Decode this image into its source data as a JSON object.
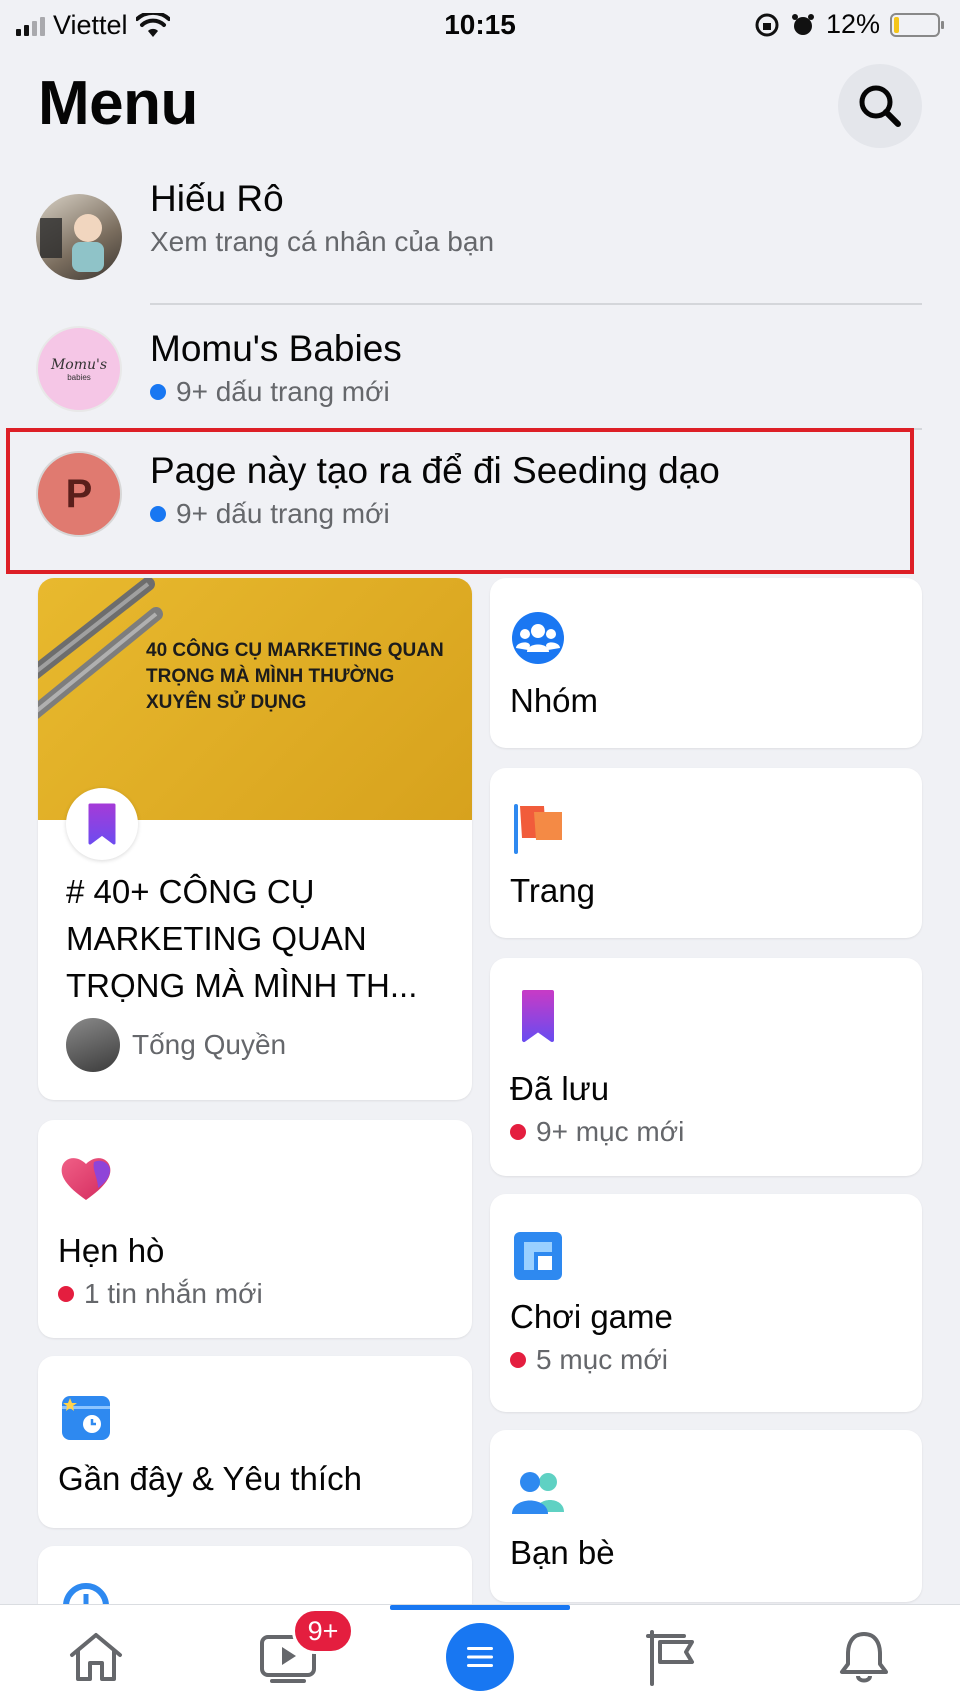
{
  "status_bar": {
    "carrier": "Viettel",
    "time": "10:15",
    "battery": "12%",
    "battery_level": 0.12
  },
  "header": {
    "title": "Menu"
  },
  "profiles": [
    {
      "name": "Hiếu Rô",
      "subtitle": "Xem trang cá nhân của bạn"
    },
    {
      "name": "Momu's Babies",
      "subtitle": "9+ dấu trang mới",
      "avatar_text": "Momu's",
      "avatar_subtext": "babies"
    },
    {
      "name": "Page này tạo ra để đi Seeding dạo",
      "subtitle": "9+ dấu trang mới",
      "avatar_letter": "P"
    }
  ],
  "article_card": {
    "image_text": "40 CÔNG CỤ MARKETING QUAN TRỌNG MÀ MÌNH THƯỜNG XUYÊN SỬ DỤNG",
    "title": "# 40+ CÔNG CỤ MARKETING QUAN TRỌNG MÀ MÌNH TH...",
    "author": "Tống Quyền"
  },
  "shortcuts": {
    "groups": {
      "label": "Nhóm",
      "icon": "groups-icon"
    },
    "pages": {
      "label": "Trang",
      "icon": "flag-icon"
    },
    "saved": {
      "label": "Đã lưu",
      "sub": "9+ mục mới",
      "icon": "bookmark-icon"
    },
    "dating": {
      "label": "Hẹn hò",
      "sub": "1 tin nhắn mới",
      "icon": "heart-icon"
    },
    "gaming": {
      "label": "Chơi game",
      "sub": "5 mục mới",
      "icon": "gaming-icon"
    },
    "recent": {
      "label": "Gần đây & Yêu thích",
      "icon": "recent-favorites-icon"
    },
    "friends": {
      "label": "Bạn bè",
      "icon": "friends-icon"
    }
  },
  "tabbar": {
    "watch_badge": "9+",
    "tabs": [
      "home-icon",
      "watch-icon",
      "menu-icon",
      "pages-flag-icon",
      "notifications-icon"
    ],
    "active": "menu-icon",
    "accent": "#1877f2"
  }
}
